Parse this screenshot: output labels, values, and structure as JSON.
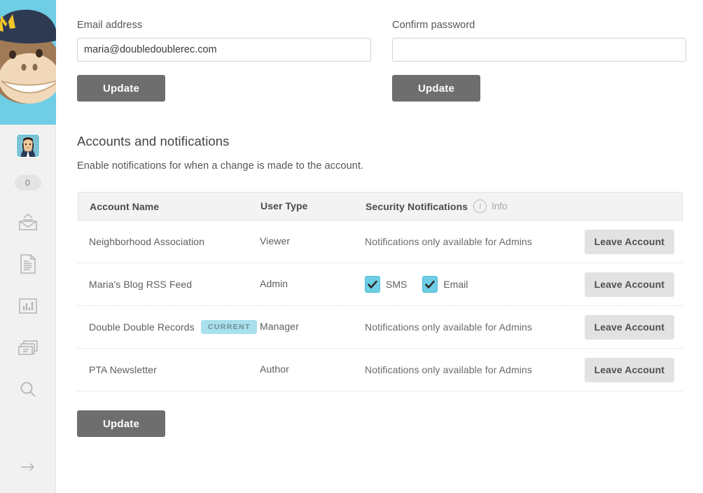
{
  "sidebar": {
    "logo": {
      "icon": "mailchimp-freddie-logo",
      "bg_color": "#6fcde5"
    },
    "avatar": {
      "icon": "user-avatar",
      "alt": "Maria"
    },
    "count_badge": "0",
    "items": [
      {
        "icon": "campaigns-envelope-icon",
        "label": "Campaigns"
      },
      {
        "icon": "templates-document-icon",
        "label": "Templates"
      },
      {
        "icon": "reports-bar-chart-icon",
        "label": "Reports"
      },
      {
        "icon": "lists-cards-icon",
        "label": "Lists"
      },
      {
        "icon": "search-icon",
        "label": "Search"
      }
    ],
    "expand": {
      "icon": "arrow-right-icon",
      "label": "Expand"
    }
  },
  "account_form": {
    "email": {
      "label": "Email address",
      "value": "maria@doubledoublerec.com",
      "placeholder": "",
      "update_label": "Update"
    },
    "password": {
      "label": "Confirm password",
      "value": "",
      "placeholder": "",
      "update_label": "Update"
    }
  },
  "accounts_section": {
    "title": "Accounts and notifications",
    "subtitle": "Enable notifications for when a change is made to the account.",
    "update_label": "Update",
    "table": {
      "headers": {
        "account_name": "Account Name",
        "user_type": "User Type",
        "security_notifications": "Security Notifications",
        "info_label": "Info",
        "info_icon": "info-circle-icon"
      },
      "rows": [
        {
          "account_name": "Neighborhood Association",
          "badge": "",
          "user_type": "Viewer",
          "notifications_text": "Notifications only available for Admins",
          "checkboxes": [],
          "action_label": "Leave Account"
        },
        {
          "account_name": "Maria's Blog RSS Feed",
          "badge": "",
          "user_type": "Admin",
          "notifications_text": "",
          "checkboxes": [
            {
              "label": "SMS",
              "checked": true
            },
            {
              "label": "Email",
              "checked": true
            }
          ],
          "action_label": "Leave Account"
        },
        {
          "account_name": "Double Double Records",
          "badge": "CURRENT",
          "user_type": "Manager",
          "notifications_text": "Notifications only available for Admins",
          "checkboxes": [],
          "action_label": "Leave Account"
        },
        {
          "account_name": "PTA Newsletter",
          "badge": "",
          "user_type": "Author",
          "notifications_text": "Notifications only available for Admins",
          "checkboxes": [],
          "action_label": "Leave Account"
        }
      ]
    }
  },
  "colors": {
    "accent_blue": "#6fcde5",
    "badge_blue": "#a8e0ed",
    "button_gray": "#6e6e6e",
    "leave_button_gray": "#e2e2e2",
    "sidebar_bg": "#f1f1f1",
    "header_row_bg": "#f3f3f3"
  }
}
